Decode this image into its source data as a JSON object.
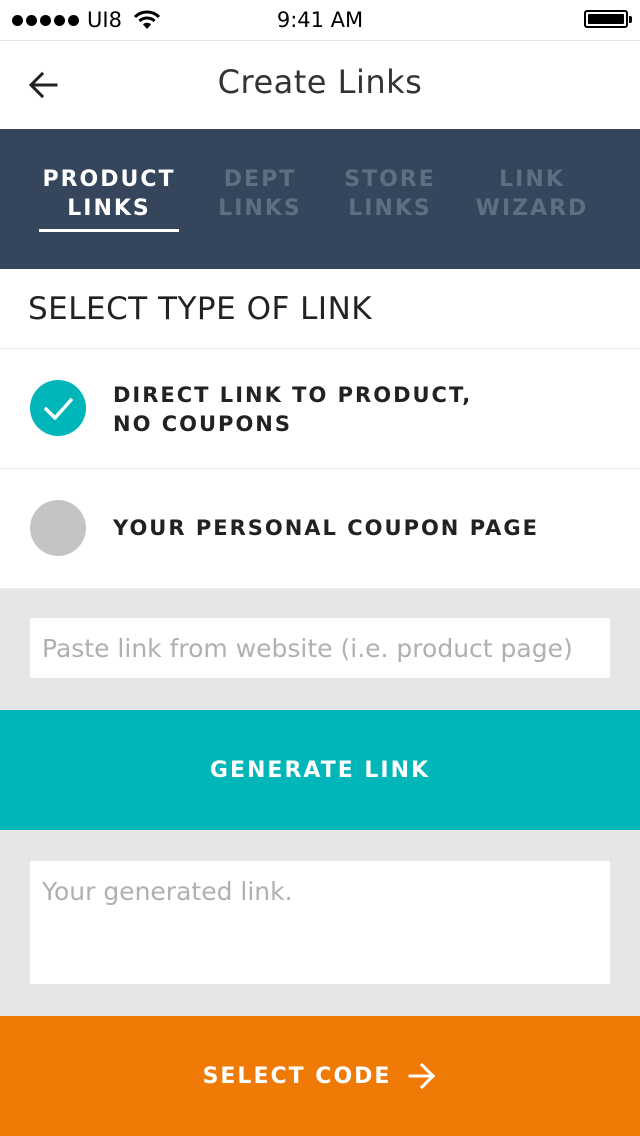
{
  "status_bar": {
    "carrier": "UI8",
    "time": "9:41 AM",
    "icons": [
      "signal-dots-icon",
      "wifi-icon",
      "battery-icon"
    ]
  },
  "header": {
    "title": "Create Links",
    "back_icon": "arrow-left-icon"
  },
  "tabs": [
    {
      "label": "PRODUCT\nLINKS",
      "active": true
    },
    {
      "label": "DEPT\nLINKS",
      "active": false
    },
    {
      "label": "STORE\nLINKS",
      "active": false
    },
    {
      "label": "LINK\nWIZARD",
      "active": false
    }
  ],
  "section": {
    "title": "SELECT TYPE OF LINK"
  },
  "options": [
    {
      "label": "DIRECT LINK TO PRODUCT,\nNO COUPONS",
      "selected": true
    },
    {
      "label": "YOUR PERSONAL COUPON PAGE",
      "selected": false
    }
  ],
  "link_input": {
    "value": "",
    "placeholder": "Paste link from website (i.e. product page)"
  },
  "generate_button": {
    "label": "GENERATE LINK"
  },
  "generated_output": {
    "value": "",
    "placeholder": "Your generated link."
  },
  "select_button": {
    "label": "SELECT CODE",
    "icon": "arrow-right-icon"
  },
  "colors": {
    "tab_bar_bg": "#35465c",
    "tab_inactive": "#5f6f82",
    "accent_teal": "#00b6b9",
    "accent_orange": "#ef7a06",
    "radio_unselected": "#c4c4c4",
    "page_bg": "#e6e6e6"
  }
}
